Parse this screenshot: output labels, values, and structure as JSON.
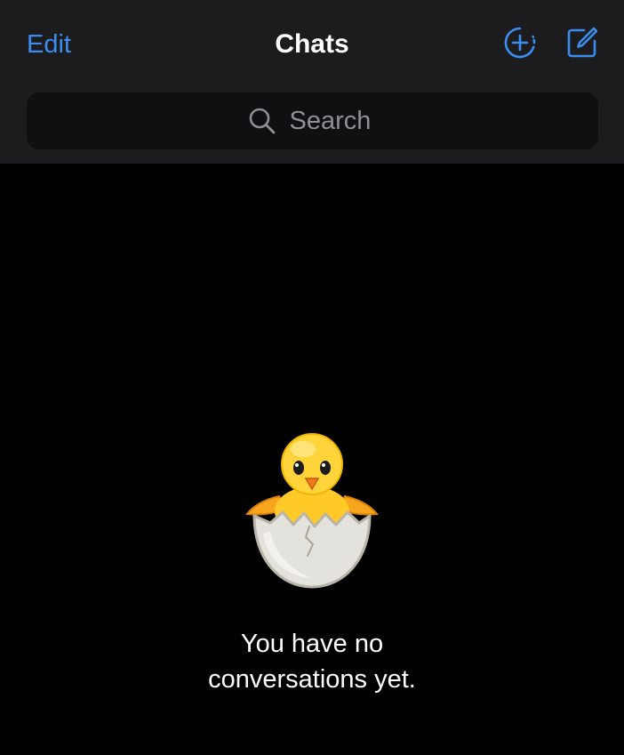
{
  "header": {
    "edit_label": "Edit",
    "title": "Chats",
    "new_story_icon": "circle-plus-icon",
    "compose_icon": "compose-icon"
  },
  "search": {
    "placeholder": "Search",
    "value": ""
  },
  "empty_state": {
    "illustration": "hatching-chick-sticker",
    "line1": "You have no",
    "line2": "conversations yet."
  },
  "colors": {
    "accent": "#3b8ef0",
    "header_bg": "#1c1c1e",
    "search_bg": "#101012",
    "background": "#000000",
    "placeholder": "#8e8e93"
  }
}
